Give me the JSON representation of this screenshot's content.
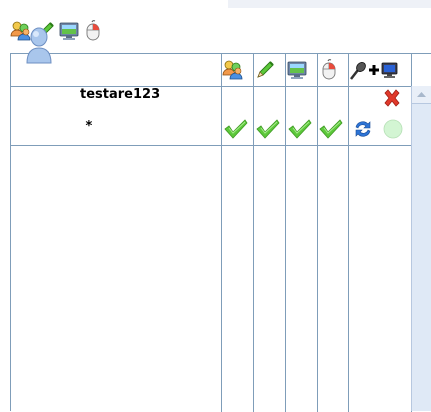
{
  "toolbar": {
    "icons": [
      "users-icon",
      "pencil-icon",
      "monitor-icon",
      "mouse-icon"
    ]
  },
  "table": {
    "header_icons": [
      "users-icon",
      "pencil-icon",
      "monitor-icon",
      "mouse-icon",
      "microphone-plus-screen-icon"
    ],
    "rows": [
      {
        "username": "testare123",
        "status": "*",
        "avatar": "user-avatar-icon",
        "permissions": [
          true,
          true,
          true,
          true
        ],
        "actions": [
          "remove-user-icon",
          "refresh-icon",
          "status-light-icon"
        ]
      }
    ]
  },
  "colors": {
    "grid": "#7f9db9",
    "check": "#5cc83a",
    "remove": "#d93b2b",
    "refresh": "#2d74d6",
    "status_light": "#c8f2c8"
  }
}
